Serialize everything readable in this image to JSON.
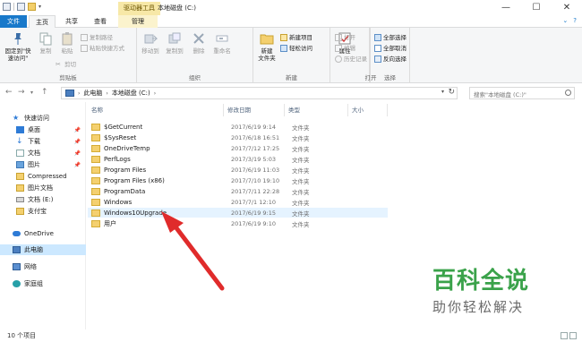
{
  "titlebar": {
    "context_tab": "驱动器工具",
    "title": "本地磁盘 (C:)",
    "minimize": "—",
    "maximize": "☐",
    "close": "✕"
  },
  "tabs": {
    "file": "文件",
    "home": "主页",
    "share": "共享",
    "view": "查看",
    "manage": "管理"
  },
  "ribbon": {
    "clipboard": {
      "label": "剪贴板",
      "pin": "固定到\"快\n速访问\"",
      "copy": "复制",
      "paste": "粘贴",
      "cut": "剪切",
      "copy_path": "复制路径",
      "paste_shortcut": "粘贴快捷方式"
    },
    "organize": {
      "label": "组织",
      "move_to": "移动到",
      "copy_to": "复制到",
      "delete": "删除",
      "rename": "重命名"
    },
    "new": {
      "label": "新建",
      "new_folder": "新建\n文件夹",
      "new_item": "新建项目",
      "easy_access": "轻松访问"
    },
    "open": {
      "label": "打开",
      "properties": "属性",
      "open": "打开",
      "edit": "编辑",
      "history": "历史记录"
    },
    "select": {
      "label": "选择",
      "select_all": "全部选择",
      "select_none": "全部取消",
      "invert": "反向选择"
    }
  },
  "address": {
    "segments": [
      "此电脑",
      "本地磁盘 (C:)"
    ],
    "search_placeholder": "搜索\"本地磁盘 (C:)\""
  },
  "navpane": [
    {
      "label": "快速访问",
      "pinned": false
    },
    {
      "label": "桌面",
      "pinned": true
    },
    {
      "label": "下载",
      "pinned": true
    },
    {
      "label": "文档",
      "pinned": true
    },
    {
      "label": "图片",
      "pinned": true
    },
    {
      "label": "Compressed",
      "pinned": false
    },
    {
      "label": "图片文档",
      "pinned": false
    },
    {
      "label": "文档 (E:)",
      "pinned": false
    },
    {
      "label": "支付宝",
      "pinned": false
    },
    {
      "label": "OneDrive",
      "pinned": false
    },
    {
      "label": "此电脑",
      "pinned": false
    },
    {
      "label": "网络",
      "pinned": false
    },
    {
      "label": "家庭组",
      "pinned": false
    }
  ],
  "columns": {
    "name": "名称",
    "date": "修改日期",
    "type": "类型",
    "size": "大小"
  },
  "files": [
    {
      "name": "$GetCurrent",
      "date": "2017/6/19 9:14",
      "type": "文件夹"
    },
    {
      "name": "$SysReset",
      "date": "2017/6/18 16:51",
      "type": "文件夹"
    },
    {
      "name": "OneDriveTemp",
      "date": "2017/7/12 17:25",
      "type": "文件夹"
    },
    {
      "name": "PerfLogs",
      "date": "2017/3/19 5:03",
      "type": "文件夹"
    },
    {
      "name": "Program Files",
      "date": "2017/6/19 11:03",
      "type": "文件夹"
    },
    {
      "name": "Program Files (x86)",
      "date": "2017/7/10 19:10",
      "type": "文件夹"
    },
    {
      "name": "ProgramData",
      "date": "2017/7/11 22:28",
      "type": "文件夹"
    },
    {
      "name": "Windows",
      "date": "2017/7/1 12:10",
      "type": "文件夹"
    },
    {
      "name": "Windows10Upgrade",
      "date": "2017/6/19 9:15",
      "type": "文件夹"
    },
    {
      "name": "用户",
      "date": "2017/6/19 9:10",
      "type": "文件夹"
    }
  ],
  "status": {
    "count": "10 个项目"
  },
  "watermark": {
    "title": "百科全说",
    "subtitle": "助你轻松解决"
  },
  "colors": {
    "accent": "#1979ca",
    "arrow": "#e02b2b",
    "watermark_green": "#3aa24a"
  }
}
